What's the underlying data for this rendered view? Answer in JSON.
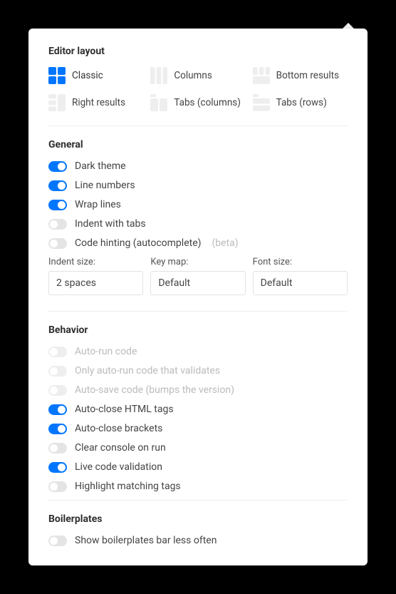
{
  "colors": {
    "accent": "#0076ff"
  },
  "sections": {
    "layout": {
      "title": "Editor layout",
      "options": [
        {
          "id": "classic",
          "label": "Classic",
          "active": true
        },
        {
          "id": "columns",
          "label": "Columns",
          "active": false
        },
        {
          "id": "bottom-results",
          "label": "Bottom results",
          "active": false
        },
        {
          "id": "right-results",
          "label": "Right results",
          "active": false
        },
        {
          "id": "tabs-columns",
          "label": "Tabs (columns)",
          "active": false
        },
        {
          "id": "tabs-rows",
          "label": "Tabs (rows)",
          "active": false
        }
      ]
    },
    "general": {
      "title": "General",
      "toggles": [
        {
          "label": "Dark theme",
          "on": true,
          "disabled": false
        },
        {
          "label": "Line numbers",
          "on": true,
          "disabled": false
        },
        {
          "label": "Wrap lines",
          "on": true,
          "disabled": false
        },
        {
          "label": "Indent with tabs",
          "on": false,
          "disabled": false
        },
        {
          "label": "Code hinting (autocomplete)",
          "on": false,
          "disabled": false,
          "suffix": "(beta)"
        }
      ],
      "fields": [
        {
          "label": "Indent size:",
          "value": "2 spaces"
        },
        {
          "label": "Key map:",
          "value": "Default"
        },
        {
          "label": "Font size:",
          "value": "Default"
        }
      ]
    },
    "behavior": {
      "title": "Behavior",
      "toggles": [
        {
          "label": "Auto-run code",
          "on": false,
          "disabled": true
        },
        {
          "label": "Only auto-run code that validates",
          "on": false,
          "disabled": true
        },
        {
          "label": "Auto-save code (bumps the version)",
          "on": false,
          "disabled": true
        },
        {
          "label": "Auto-close HTML tags",
          "on": true,
          "disabled": false
        },
        {
          "label": "Auto-close brackets",
          "on": true,
          "disabled": false
        },
        {
          "label": "Clear console on run",
          "on": false,
          "disabled": false
        },
        {
          "label": "Live code validation",
          "on": true,
          "disabled": false
        },
        {
          "label": "Highlight matching tags",
          "on": false,
          "disabled": false
        }
      ]
    },
    "boilerplates": {
      "title": "Boilerplates",
      "toggles": [
        {
          "label": "Show boilerplates bar less often",
          "on": false,
          "disabled": false
        }
      ]
    }
  }
}
